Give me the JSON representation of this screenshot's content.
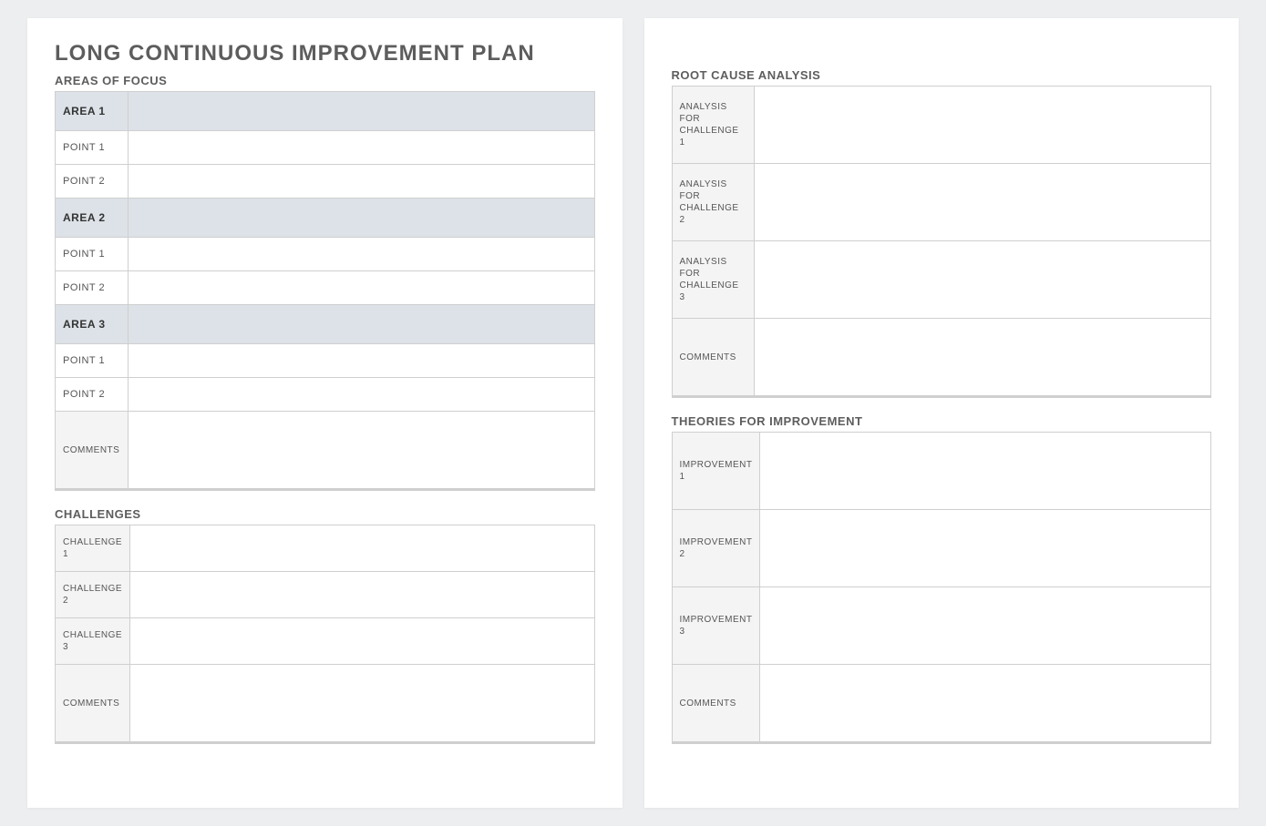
{
  "title": "LONG CONTINUOUS IMPROVEMENT PLAN",
  "areas_of_focus": {
    "heading": "AREAS OF FOCUS",
    "areas": [
      {
        "label": "AREA 1",
        "value": "",
        "points": [
          {
            "label": "POINT 1",
            "value": ""
          },
          {
            "label": "POINT 2",
            "value": ""
          }
        ]
      },
      {
        "label": "AREA 2",
        "value": "",
        "points": [
          {
            "label": "POINT 1",
            "value": ""
          },
          {
            "label": "POINT 2",
            "value": ""
          }
        ]
      },
      {
        "label": "AREA 3",
        "value": "",
        "points": [
          {
            "label": "POINT 1",
            "value": ""
          },
          {
            "label": "POINT 2",
            "value": ""
          }
        ]
      }
    ],
    "comments_label": "COMMENTS",
    "comments": ""
  },
  "challenges": {
    "heading": "CHALLENGES",
    "rows": [
      {
        "label": "CHALLENGE 1",
        "value": ""
      },
      {
        "label": "CHALLENGE 2",
        "value": ""
      },
      {
        "label": "CHALLENGE 3",
        "value": ""
      }
    ],
    "comments_label": "COMMENTS",
    "comments": ""
  },
  "root_cause": {
    "heading": "ROOT CAUSE ANALYSIS",
    "rows": [
      {
        "label": "ANALYSIS FOR CHALLENGE 1",
        "value": ""
      },
      {
        "label": "ANALYSIS FOR CHALLENGE 2",
        "value": ""
      },
      {
        "label": "ANALYSIS FOR CHALLENGE 3",
        "value": ""
      }
    ],
    "comments_label": "COMMENTS",
    "comments": ""
  },
  "theories": {
    "heading": "THEORIES FOR IMPROVEMENT",
    "rows": [
      {
        "label": "IMPROVEMENT 1",
        "value": ""
      },
      {
        "label": "IMPROVEMENT 2",
        "value": ""
      },
      {
        "label": "IMPROVEMENT 3",
        "value": ""
      }
    ],
    "comments_label": "COMMENTS",
    "comments": ""
  }
}
